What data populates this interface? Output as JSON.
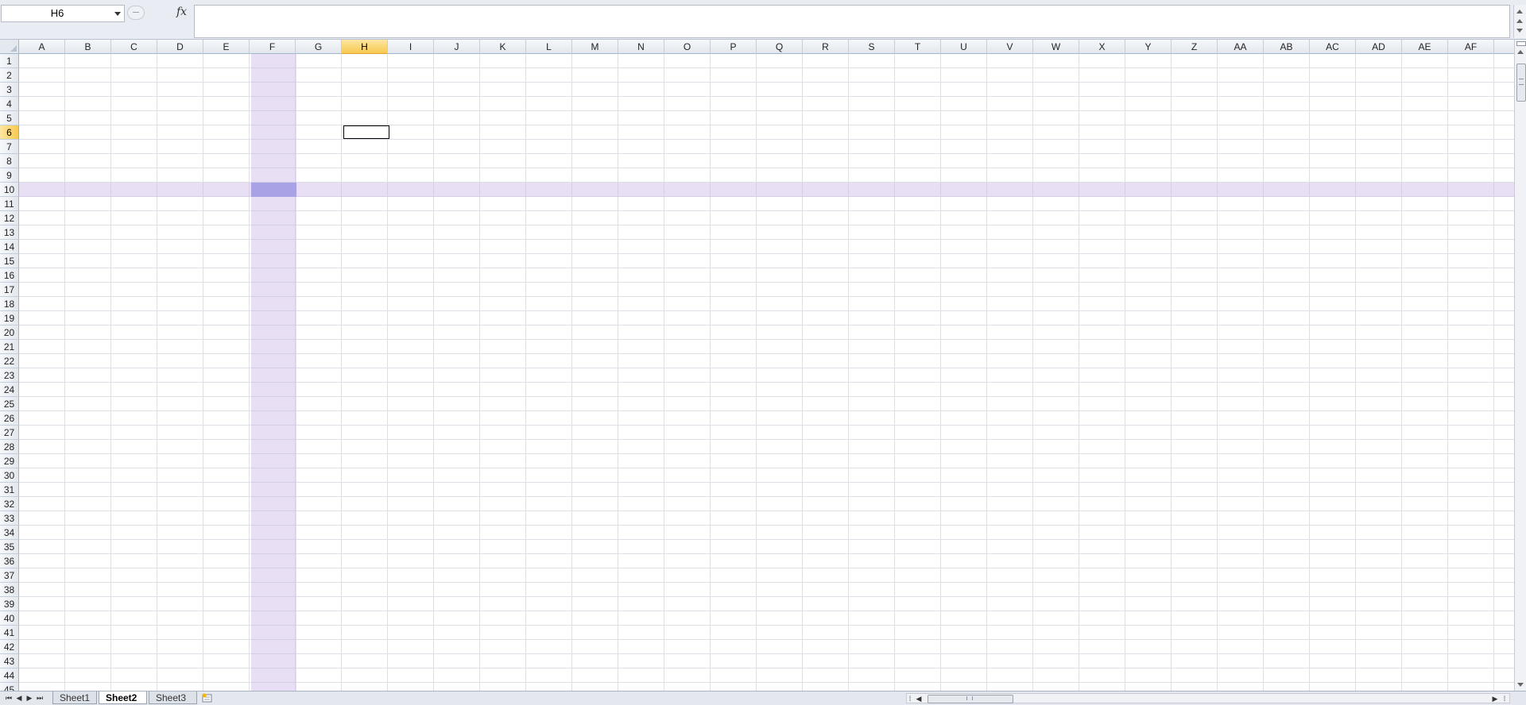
{
  "formula_bar": {
    "name_box": "H6",
    "fx_label": "fx",
    "formula": ""
  },
  "columns": [
    "A",
    "B",
    "C",
    "D",
    "E",
    "F",
    "G",
    "H",
    "I",
    "J",
    "K",
    "L",
    "M",
    "N",
    "O",
    "P",
    "Q",
    "R",
    "S",
    "T",
    "U",
    "V",
    "W",
    "X",
    "Y",
    "Z",
    "AA",
    "AB",
    "AC",
    "AD",
    "AE",
    "AF"
  ],
  "rows": [
    "1",
    "2",
    "3",
    "4",
    "5",
    "6",
    "7",
    "8",
    "9",
    "10",
    "11",
    "12",
    "13",
    "14",
    "15",
    "16",
    "17",
    "18",
    "19",
    "20",
    "21",
    "22",
    "23",
    "24",
    "25",
    "26",
    "27",
    "28",
    "29",
    "30",
    "31",
    "32",
    "33",
    "34",
    "35",
    "36",
    "37",
    "38",
    "39",
    "40",
    "41",
    "42",
    "43",
    "44",
    "45"
  ],
  "selection": {
    "active_cell": "H6",
    "highlight_col_header": "H",
    "highlight_row_header": "6",
    "purple_column": "F",
    "purple_row": "10"
  },
  "sheet_tabs": [
    {
      "label": "Sheet1",
      "active": false
    },
    {
      "label": "Sheet2",
      "active": true
    },
    {
      "label": "Sheet3",
      "active": false
    }
  ],
  "colors": {
    "selected_header": "#f7c94f",
    "highlight_band": "#ccb9e8",
    "highlight_cell": "#a9a3e6"
  }
}
